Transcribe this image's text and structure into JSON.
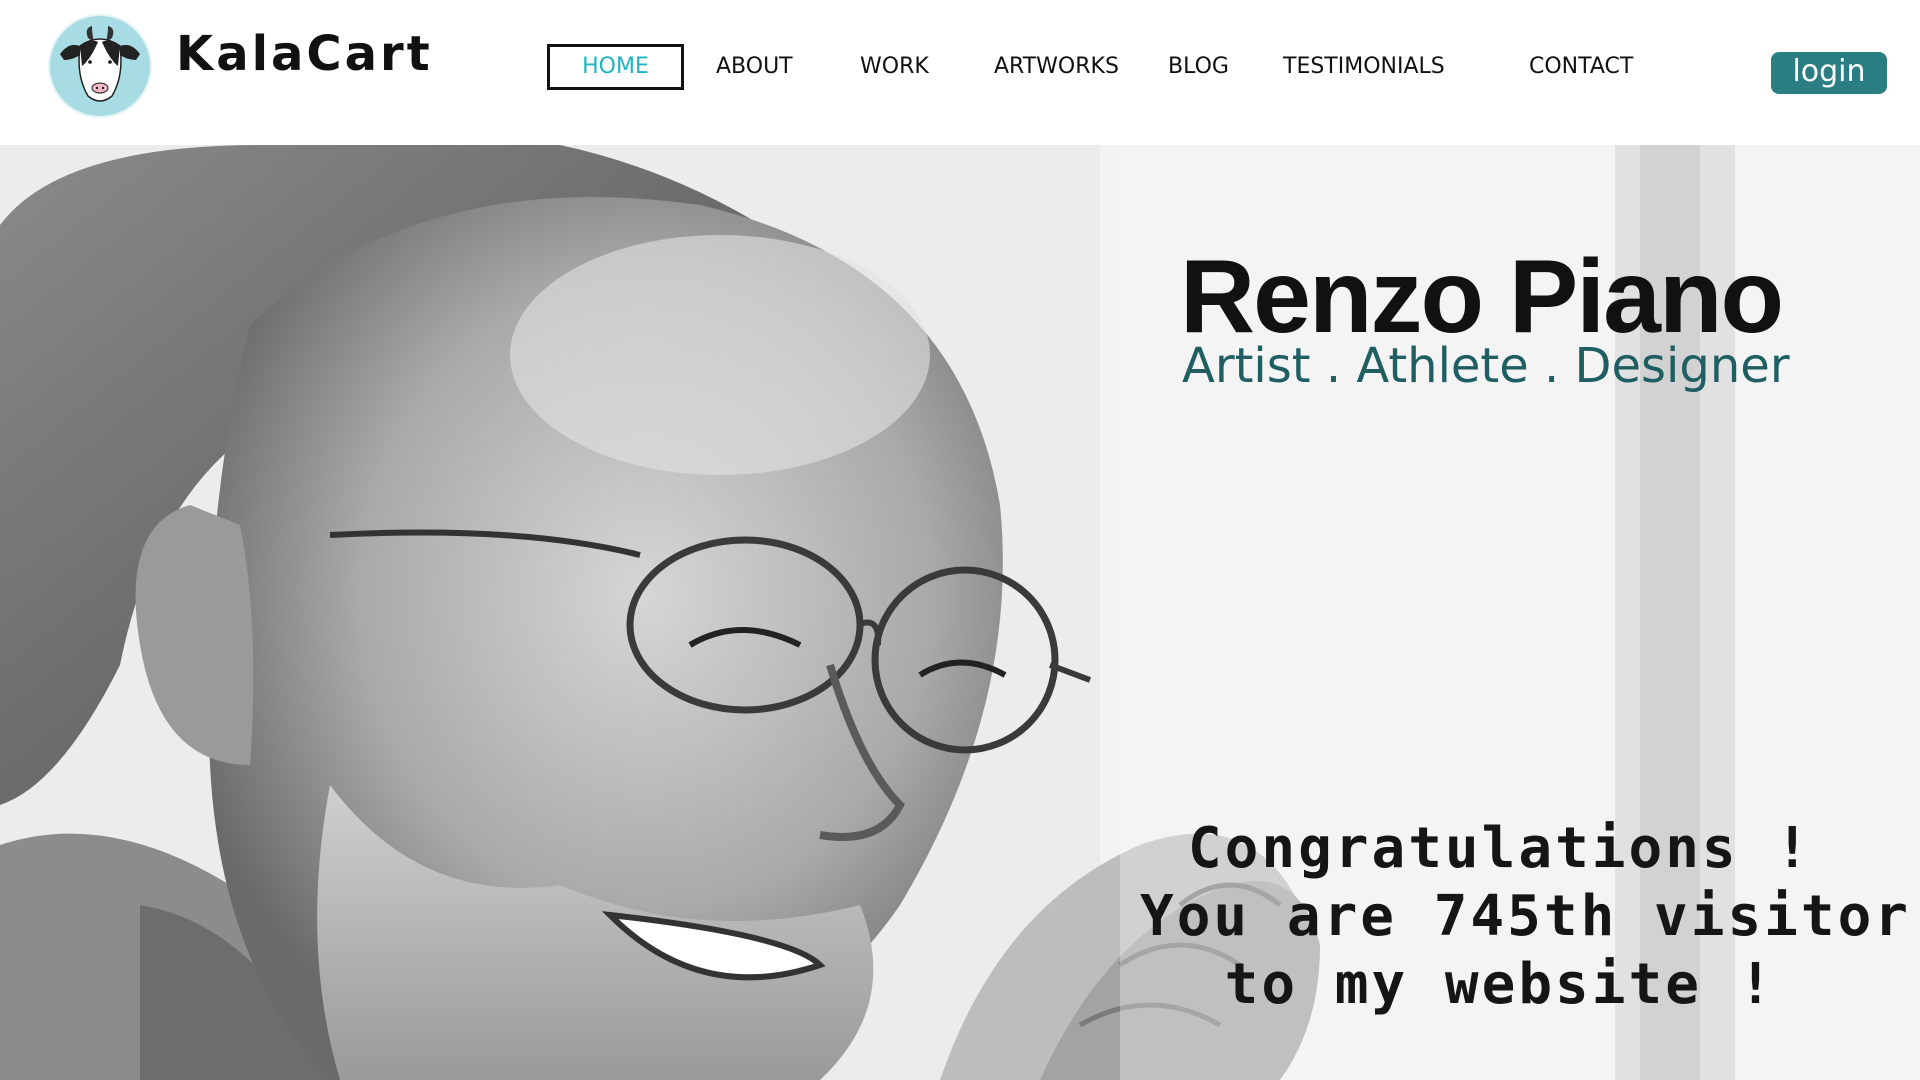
{
  "brand": {
    "name": "KalaCart",
    "logo_icon": "goat-face-icon"
  },
  "nav": {
    "items": [
      {
        "label": "HOME",
        "active": true
      },
      {
        "label": "ABOUT",
        "active": false
      },
      {
        "label": "WORK",
        "active": false
      },
      {
        "label": "ARTWORKS",
        "active": false
      },
      {
        "label": "BLOG",
        "active": false
      },
      {
        "label": "TESTIMONIALS",
        "active": false
      },
      {
        "label": "CONTACT",
        "active": false
      }
    ],
    "login_label": "login"
  },
  "hero": {
    "title": "Renzo Piano",
    "subtitle": "Artist . Athlete . Designer",
    "message": {
      "line1": "Congratulations !",
      "line2": "You are 745th visitor",
      "line3": "to my website !"
    },
    "photo_icon": "portrait-photo"
  },
  "colors": {
    "accent": "#2a7d80",
    "active_nav": "#1cb5c0",
    "subtitle": "#1f5e62"
  }
}
